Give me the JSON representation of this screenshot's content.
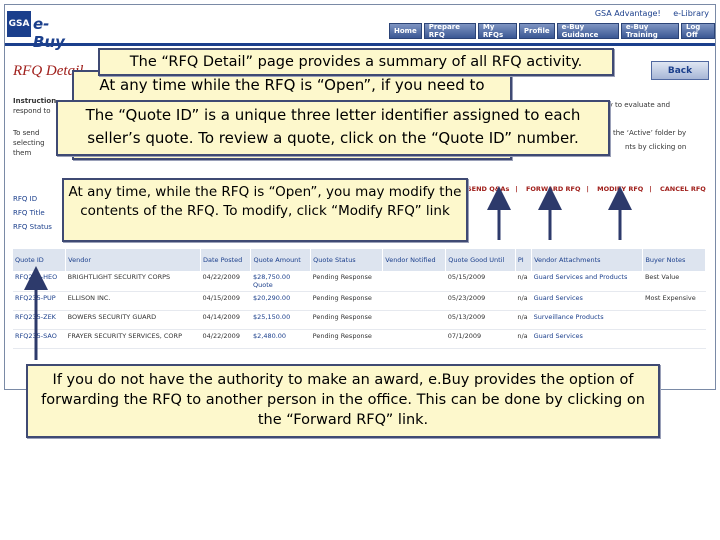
{
  "top_links": [
    "GSA Advantage!",
    "e-Library"
  ],
  "nav": [
    "Home",
    "Prepare RFQ",
    "My RFQs",
    "Profile",
    "e-Buy Guidance",
    "e-Buy Training",
    "Log Off"
  ],
  "logo": {
    "gsa": "GSA",
    "ebuy": "e-Buy"
  },
  "page_title": "RFQ Detail",
  "back_label": "Back",
  "instructions": {
    "label_1": "Instruction",
    "text_1": "respond to",
    "tail_1": "try to evaluate and",
    "tail_2": "the ‘Active’ folder by",
    "tail_3": "nts by clicking on",
    "label_2": "To send",
    "text_2": "selecting",
    "text_3": "them"
  },
  "rfq_info": [
    "RFQ ID",
    "RFQ Title",
    "RFQ Status"
  ],
  "actions": [
    "SEND Q&As",
    "FORWARD RFQ",
    "MODIFY RFQ",
    "CANCEL RFQ"
  ],
  "table": {
    "headers": [
      "Quote ID",
      "Vendor",
      "Date Posted",
      "Quote Amount",
      "Quote Status",
      "Vendor Notified",
      "Quote Good Until",
      "PI",
      "Vendor Attachments",
      "Buyer Notes"
    ],
    "rows": [
      [
        "RFQ235-HEO",
        "BRIGHTLIGHT SECURITY CORPS",
        "04/22/2009",
        "$28,750.00",
        "Pending Response",
        "",
        "05/15/2009",
        "n/a",
        "Guard Services and Products",
        "Best Value"
      ],
      [
        "RFQ235-PUP",
        "ELLISON INC.",
        "04/15/2009",
        "$20,290.00",
        "Pending Response",
        "",
        "05/23/2009",
        "n/a",
        "Guard Services",
        "Most Expensive"
      ],
      [
        "RFQ235-ZEK",
        "BOWERS SECURITY GUARD",
        "04/14/2009",
        "$25,150.00",
        "Pending Response",
        "",
        "05/13/2009",
        "n/a",
        "Surveillance Products",
        ""
      ],
      [
        "RFQ235-SAO",
        "FRAYER SECURITY SERVICES, CORP",
        "04/22/2009",
        "$2,480.00",
        "Pending Response",
        "",
        "07/1/2009",
        "n/a",
        "Guard Services",
        ""
      ]
    ],
    "extra_quote_label": "Quote"
  },
  "callouts": {
    "summary": "The “RFQ Detail” page provides a summary of all RFQ activity.",
    "open_partial": "At any time while the RFQ is “Open”, if you need to",
    "quote_id": "The “Quote ID” is a unique three letter identifier assigned to each seller’s quote. To review a quote, click on the “Quote ID” number.",
    "modify": "At any time, while the RFQ is “Open”, you may modify the contents of the RFQ. To modify, click “Modify RFQ” link",
    "forward": "If you do not have the authority to make an award, e.Buy provides the option of forwarding the RFQ to another person in the office.  This can be done by clicking on the “Forward RFQ” link."
  },
  "colors": {
    "brand": "#1b3f8c",
    "title_red": "#a0201c",
    "callout_bg": "#fdf8cc",
    "callout_border": "#3f4a73"
  }
}
